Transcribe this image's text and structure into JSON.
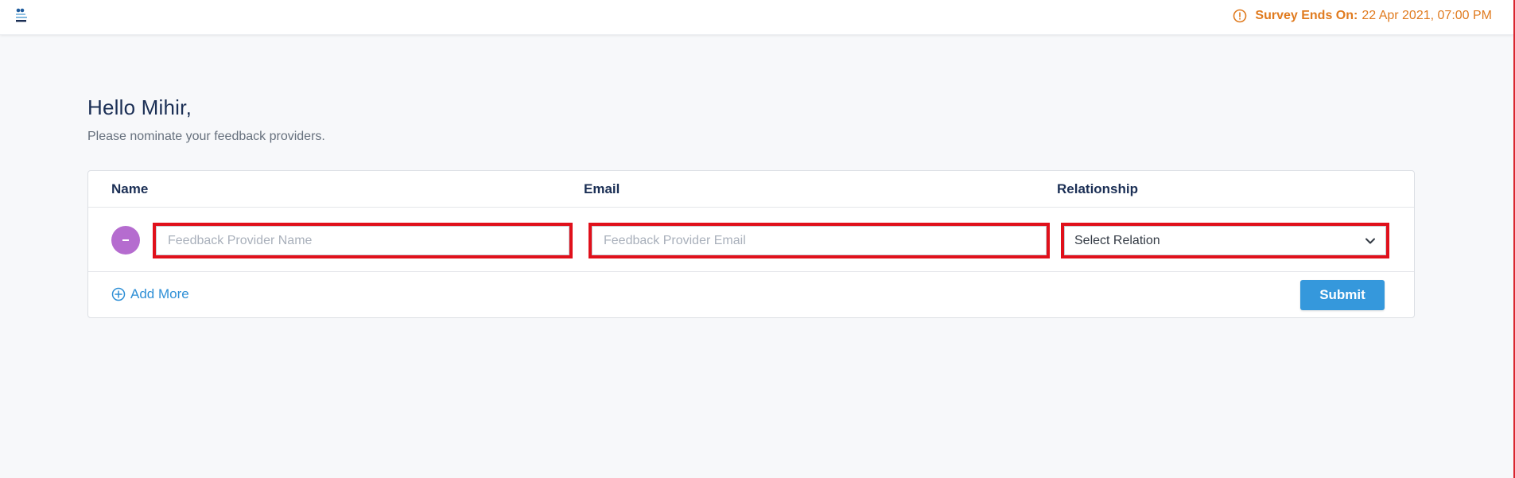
{
  "header": {
    "logo_icon": "company-logo-icon",
    "survey_end_label": "Survey Ends On:",
    "survey_end_value": "22 Apr 2021, 07:00 PM",
    "survey_end_color": "#e07b1f"
  },
  "main": {
    "greeting": "Hello Mihir,",
    "subtitle": "Please nominate your feedback providers."
  },
  "table": {
    "columns": [
      "Name",
      "Email",
      "Relationship"
    ],
    "rows": [
      {
        "name_value": "",
        "name_placeholder": "Feedback Provider Name",
        "email_value": "",
        "email_placeholder": "Feedback Provider Email",
        "relationship_selected": "Select Relation"
      }
    ]
  },
  "actions": {
    "add_more_label": "Add More",
    "submit_label": "Submit",
    "accent_color": "#3598dc",
    "remove_color": "#b56ccf"
  }
}
